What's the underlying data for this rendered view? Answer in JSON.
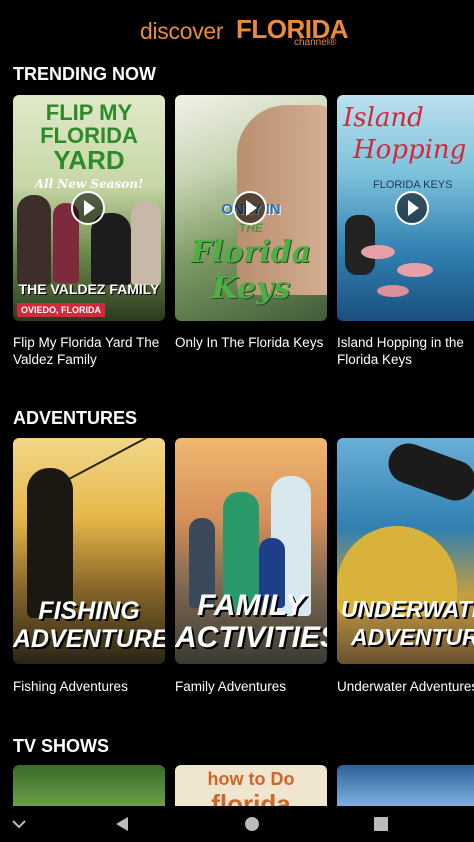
{
  "header": {
    "logo_discover": "discover",
    "logo_florida": "FLORIDA",
    "logo_channel": "channel®"
  },
  "sections": [
    {
      "title": "TRENDING NOW",
      "cards": [
        {
          "caption": "Flip My Florida Yard The Valdez Family",
          "art_title_1": "FLIP MY",
          "art_title_2": "FLORIDA",
          "art_title_3": "YARD",
          "art_subtitle": "All New Season!",
          "art_banner": "THE VALDEZ FAMILY",
          "art_location": "OVIEDO, FLORIDA"
        },
        {
          "caption": "Only In The Florida Keys",
          "art_title_1": "ONLY IN",
          "art_title_2": "THE",
          "art_title_3": "Florida",
          "art_title_4": "Keys"
        },
        {
          "caption": "Island Hopping in the Florida Keys",
          "art_title_1": "Island",
          "art_title_2": "Hopping",
          "art_subtitle": "FLORIDA KEYS"
        }
      ]
    },
    {
      "title": "ADVENTURES",
      "cards": [
        {
          "caption": "Fishing Adventures",
          "art_line_1": "FISHING",
          "art_line_2": "ADVENTURES"
        },
        {
          "caption": "Family Adventures",
          "art_line_1": "FAMILY",
          "art_line_2": "ACTIVITIES"
        },
        {
          "caption": "Underwater Adventures",
          "art_line_1": "UNDERWATER",
          "art_line_2": "ADVENTURES"
        }
      ]
    },
    {
      "title": "TV SHOWS",
      "cards": [
        {
          "caption": ""
        },
        {
          "caption": "",
          "art_line_1": "how to Do",
          "art_line_2": "florida"
        },
        {
          "caption": ""
        }
      ]
    }
  ],
  "nav": {
    "collapse_icon": "chevron-down-icon",
    "back_icon": "back-triangle-icon",
    "home_icon": "home-circle-icon",
    "recents_icon": "recents-square-icon"
  },
  "colors": {
    "background": "#000000",
    "brand_orange": "#ea8a3a",
    "text": "#ffffff"
  }
}
